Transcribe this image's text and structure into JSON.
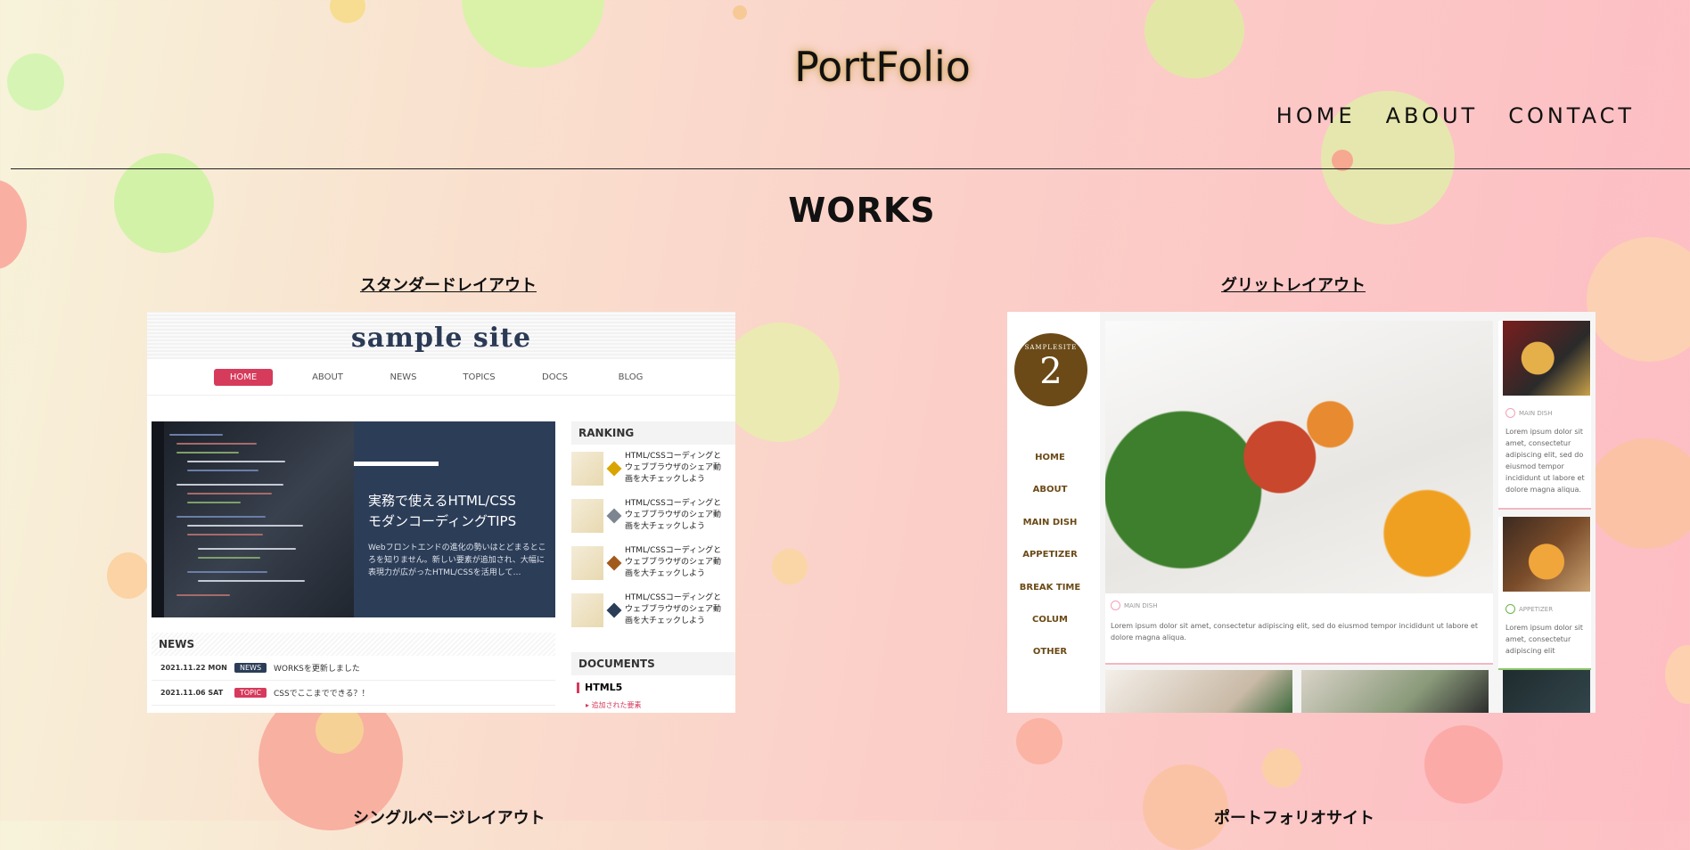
{
  "site": {
    "title": "PortFolio"
  },
  "nav": {
    "home": "HOME",
    "about": "ABOUT",
    "contact": "CONTACT"
  },
  "works": {
    "title": "WORKS",
    "items": [
      {
        "title": "スタンダードレイアウト"
      },
      {
        "title": "グリットレイアウト"
      },
      {
        "title": "シングルページレイアウト"
      },
      {
        "title": "ポートフォリオサイト"
      }
    ]
  },
  "standard_preview": {
    "logo": "sample site",
    "nav": [
      "HOME",
      "ABOUT",
      "NEWS",
      "TOPICS",
      "DOCS",
      "BLOG"
    ],
    "hero_heading_1": "実務で使えるHTML/CSS",
    "hero_heading_2": "モダンコーディングTIPS",
    "hero_text": "Webフロントエンドの進化の勢いはとどまるところを知りません。新しい要素が追加され、大幅に表現力が広がったHTML/CSSを活用して…",
    "ranking_title": "RANKING",
    "ranking": [
      {
        "rank": "1",
        "text": "HTML/CSSコーディングとウェブブラウザのシェア動画を大チェックしよう"
      },
      {
        "rank": "2",
        "text": "HTML/CSSコーディングとウェブブラウザのシェア動画を大チェックしよう"
      },
      {
        "rank": "3",
        "text": "HTML/CSSコーディングとウェブブラウザのシェア動画を大チェックしよう"
      },
      {
        "rank": "4",
        "text": "HTML/CSSコーディングとウェブブラウザのシェア動画を大チェックしよう"
      }
    ],
    "news_title": "NEWS",
    "news": [
      {
        "date": "2021.11.22 MON",
        "tag": "NEWS",
        "text": "WORKSを更新しました"
      },
      {
        "date": "2021.11.06 SAT",
        "tag": "TOPIC",
        "text": "CSSでここまでできる？！"
      }
    ],
    "documents_title": "DOCUMENTS",
    "documents_item": "HTML5",
    "documents_sub": "▸ 追加された要素"
  },
  "grid_preview": {
    "logo_top": "SAMPLESITE",
    "logo_num": "2",
    "menu": [
      "HOME",
      "ABOUT",
      "MAIN DISH",
      "APPETIZER",
      "BREAK TIME",
      "COLUM",
      "OTHER"
    ],
    "main_cat": "MAIN DISH",
    "main_text": "Lorem ipsum dolor sit amet, consectetur adipiscing elit, sed do eiusmod tempor incididunt ut labore et dolore magna aliqua.",
    "side1_cat": "MAIN DISH",
    "side1_text": "Lorem ipsum dolor sit amet, consectetur adipiscing elit, sed do eiusmod tempor incididunt ut labore et dolore magna aliqua.",
    "side2_cat": "APPETIZER",
    "side2_text": "Lorem ipsum dolor sit amet, consectetur adipiscing elit"
  }
}
